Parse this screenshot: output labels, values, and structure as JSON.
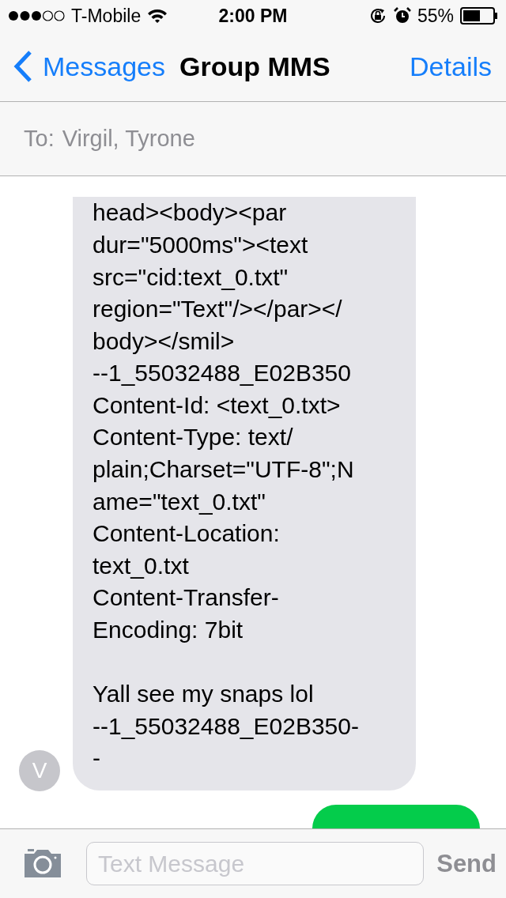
{
  "status_bar": {
    "carrier": "T-Mobile",
    "time": "2:00 PM",
    "battery": "55%"
  },
  "nav_bar": {
    "back": "Messages",
    "title": "Group MMS",
    "action": "Details"
  },
  "recipients": {
    "label": "To:",
    "names": "Virgil, Tyrone"
  },
  "messages": [
    {
      "kind": "received",
      "avatar": "V",
      "text": "head><body><par\ndur=\"5000ms\"><text\nsrc=\"cid:text_0.txt\"\nregion=\"Text\"/></par></\nbody></smil>\n--1_55032488_E02B350\nContent-Id: <text_0.txt>\nContent-Type: text/\nplain;Charset=\"UTF-8\";N\name=\"text_0.txt\"\nContent-Location:\ntext_0.txt\nContent-Transfer-\nEncoding: 7bit\n\nYall see my snaps lol\n--1_55032488_E02B350-\n-"
    },
    {
      "kind": "sent"
    }
  ],
  "compose": {
    "placeholder": "Text Message",
    "send": "Send",
    "send_disabled": true
  }
}
